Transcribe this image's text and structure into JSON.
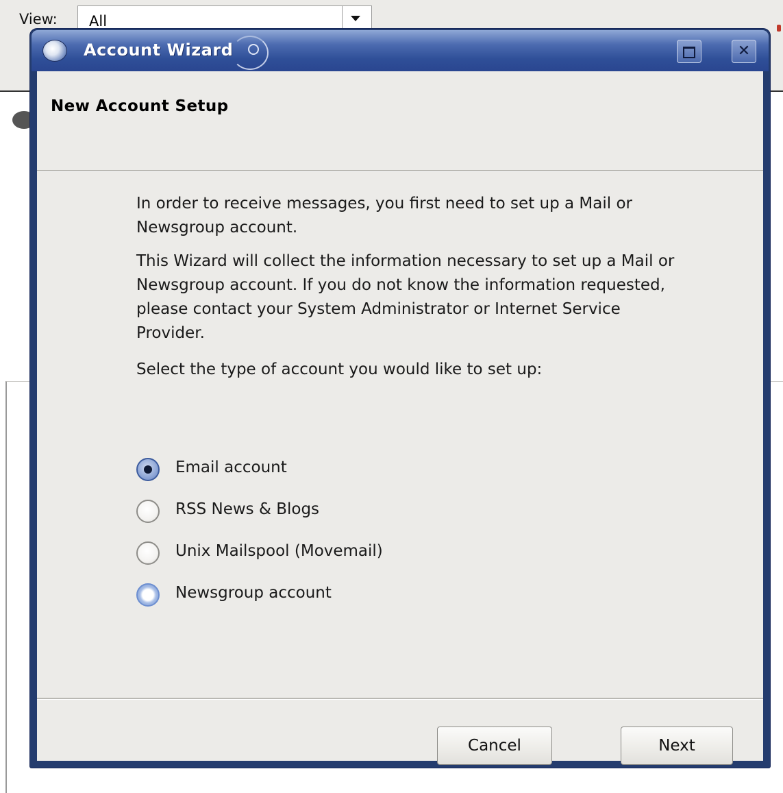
{
  "background_app": {
    "view_label": "View:",
    "view_value": "All"
  },
  "dialog": {
    "title": "Account Wizard",
    "header_title": "New Account Setup",
    "intro_text": "In order to receive messages, you first need to set up a Mail or Newsgroup account.",
    "info_text": "This Wizard will collect the information necessary to set up a Mail or Newsgroup account. If you do not know the information requested, please contact your System Administrator or Internet Service Provider.",
    "select_prompt": "Select the type of account you would like to set up:",
    "account_types": [
      {
        "label": "Email account",
        "selected": true
      },
      {
        "label": "RSS News & Blogs",
        "selected": false
      },
      {
        "label": "Unix Mailspool (Movemail)",
        "selected": false
      },
      {
        "label": "Newsgroup account",
        "selected": false,
        "focused": true
      }
    ],
    "buttons": {
      "cancel": "Cancel",
      "next": "Next"
    },
    "colors": {
      "titlebar": "#2f4f98",
      "window_bg": "#ecebe8",
      "border": "#243c6e"
    }
  }
}
